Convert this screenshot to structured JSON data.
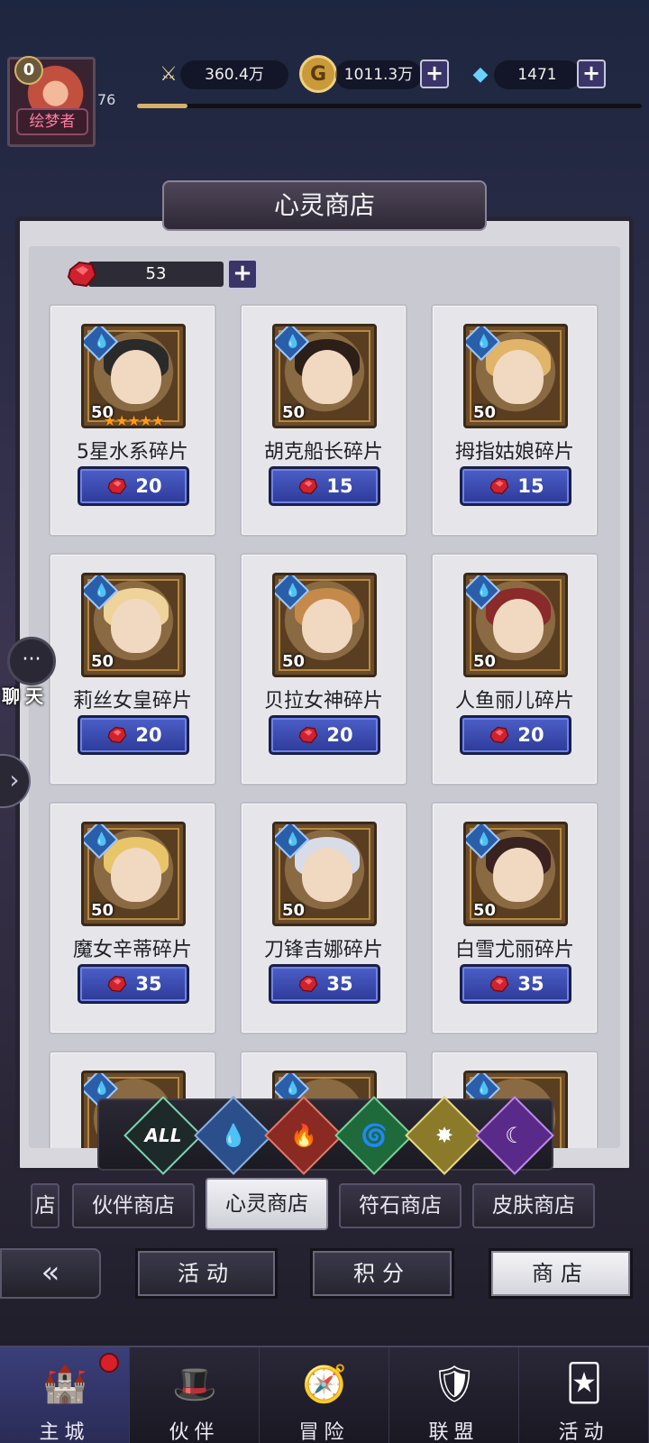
{
  "player": {
    "vip": "0",
    "level": "76",
    "title": "绘梦者",
    "exp_fraction": 0.1
  },
  "resources": {
    "power": "360.4万",
    "gold": "1011.3万",
    "diamonds": "1471"
  },
  "shop": {
    "title": "心灵商店",
    "currency_amount": "53",
    "items": [
      {
        "name": "5星水系碎片",
        "level": "50",
        "price": "20",
        "stars": "★★★★★",
        "hair": "#2a2a2a"
      },
      {
        "name": "胡克船长碎片",
        "level": "50",
        "price": "15",
        "stars": "",
        "hair": "#2b1f18"
      },
      {
        "name": "拇指姑娘碎片",
        "level": "50",
        "price": "15",
        "stars": "",
        "hair": "#e0b56a"
      },
      {
        "name": "莉丝女皇碎片",
        "level": "50",
        "price": "20",
        "stars": "",
        "hair": "#eed39a"
      },
      {
        "name": "贝拉女神碎片",
        "level": "50",
        "price": "20",
        "stars": "",
        "hair": "#c58a4a"
      },
      {
        "name": "人鱼丽儿碎片",
        "level": "50",
        "price": "20",
        "stars": "",
        "hair": "#8a2a2a"
      },
      {
        "name": "魔女辛蒂碎片",
        "level": "50",
        "price": "35",
        "stars": "",
        "hair": "#e8c56a"
      },
      {
        "name": "刀锋吉娜碎片",
        "level": "50",
        "price": "35",
        "stars": "",
        "hair": "#d8dce8"
      },
      {
        "name": "白雪尤丽碎片",
        "level": "50",
        "price": "35",
        "stars": "",
        "hair": "#3a2220"
      }
    ]
  },
  "filters": [
    {
      "label": "ALL",
      "color": "#1e2a2a",
      "border": "#7ad6b0"
    },
    {
      "label": "💧",
      "color": "#2a4f8a",
      "border": "#8ab0e0"
    },
    {
      "label": "🔥",
      "color": "#8a2a22",
      "border": "#e07a6a"
    },
    {
      "label": "🌀",
      "color": "#1e6a3a",
      "border": "#7ad09a"
    },
    {
      "label": "✸",
      "color": "#8a7a2a",
      "border": "#e8d88a"
    },
    {
      "label": "☾",
      "color": "#5a2a8a",
      "border": "#c08ae8"
    }
  ],
  "tabs": [
    "店",
    "伙伴商店",
    "心灵商店",
    "符石商店",
    "皮肤商店"
  ],
  "subnav": [
    "活动",
    "积分",
    "商店"
  ],
  "chat_label": "聊天",
  "bottom_nav": [
    {
      "label": "主城",
      "icon": "🏰"
    },
    {
      "label": "伙伴",
      "icon": "🎩"
    },
    {
      "label": "冒险",
      "icon": "🧭"
    },
    {
      "label": "联盟",
      "icon": "🛡"
    },
    {
      "label": "活动",
      "icon": "🃏"
    }
  ]
}
